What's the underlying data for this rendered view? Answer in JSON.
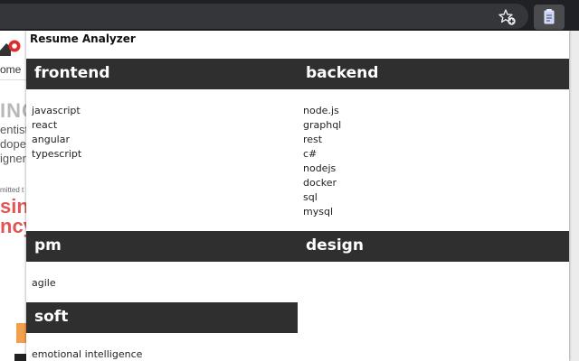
{
  "browser": {
    "star_icon": "star-add-icon",
    "extension_icon": "extension-icon",
    "colors": {
      "toolbar": "#202124",
      "omnibox": "#35363a",
      "extension_button": "#4a4b4f"
    }
  },
  "background_page": {
    "home_label": "ome",
    "big_text": "INC",
    "lines": [
      "entist",
      "dope",
      "igner"
    ],
    "small_text": "mitted t",
    "red_lines": [
      "sing",
      "ncy"
    ],
    "colors": {
      "red": "#e25555",
      "orange": "#f2a04b"
    }
  },
  "popup": {
    "title": "Resume Analyzer",
    "colors": {
      "header_bg": "#2f2f2f",
      "header_text": "#ffffff"
    },
    "categories": [
      {
        "name": "frontend",
        "skills": [
          "javascript",
          "react",
          "angular",
          "typescript"
        ]
      },
      {
        "name": "backend",
        "skills": [
          "node.js",
          "graphql",
          "rest",
          "c#",
          "nodejs",
          "docker",
          "sql",
          "mysql"
        ]
      },
      {
        "name": "pm",
        "skills": [
          "agile"
        ]
      },
      {
        "name": "design",
        "skills": []
      },
      {
        "name": "soft",
        "skills": [
          "emotional intelligence"
        ]
      }
    ]
  }
}
